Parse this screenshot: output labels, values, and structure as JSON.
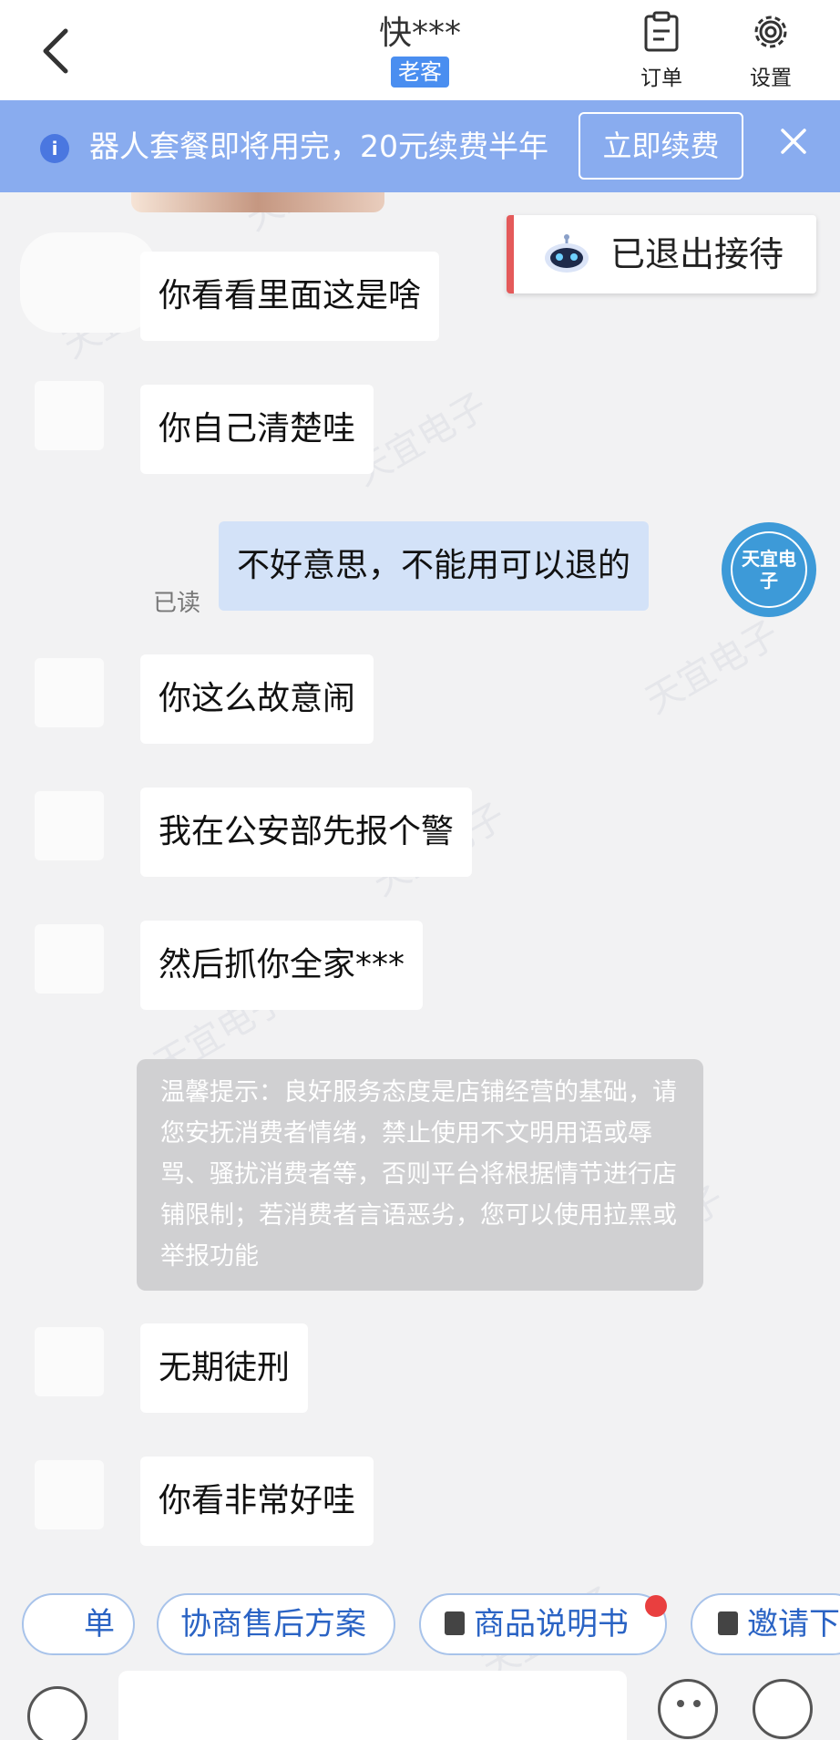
{
  "header": {
    "title": "快***",
    "badge": "老客",
    "order_label": "订单",
    "settings_label": "设置"
  },
  "banner": {
    "text": "器人套餐即将用完，20元续费半年",
    "renew_label": "立即续费",
    "close_icon": "close-icon"
  },
  "status_chip": {
    "text": "已退出接待",
    "icon": "robot-icon",
    "accent": "#e45a5a"
  },
  "messages": [
    {
      "side": "customer",
      "text": "你看看里面这是啥"
    },
    {
      "side": "customer",
      "text": "你自己清楚哇"
    },
    {
      "side": "store",
      "text": "不好意思，不能用可以退的",
      "read_label": "已读"
    },
    {
      "side": "customer",
      "text": "你这么故意闹"
    },
    {
      "side": "customer",
      "text": "我在公安部先报个警"
    },
    {
      "side": "customer",
      "text": "然后抓你全家***"
    },
    {
      "side": "customer",
      "text": "无期徒刑"
    },
    {
      "side": "customer",
      "text": "你看非常好哇"
    }
  ],
  "notice": {
    "text": "温馨提示：良好服务态度是店铺经营的基础，请您安抚消费者情绪，禁止使用不文明用语或辱骂、骚扰消费者等，否则平台将根据情节进行店铺限制；若消费者言语恶劣，您可以使用拉黑或举报功能"
  },
  "store_avatar": {
    "text": "天宜电子"
  },
  "watermark": "天宜电子",
  "quick_actions": [
    {
      "label": "单"
    },
    {
      "label": "协商售后方案"
    },
    {
      "label": "商品说明书",
      "has_red_dot": true
    },
    {
      "label": "邀请下"
    }
  ],
  "colors": {
    "primary": "#4a8ef0",
    "banner_bg": "#89acef",
    "own_bubble": "#d3e2f8",
    "chip_text": "#2a63c4"
  }
}
